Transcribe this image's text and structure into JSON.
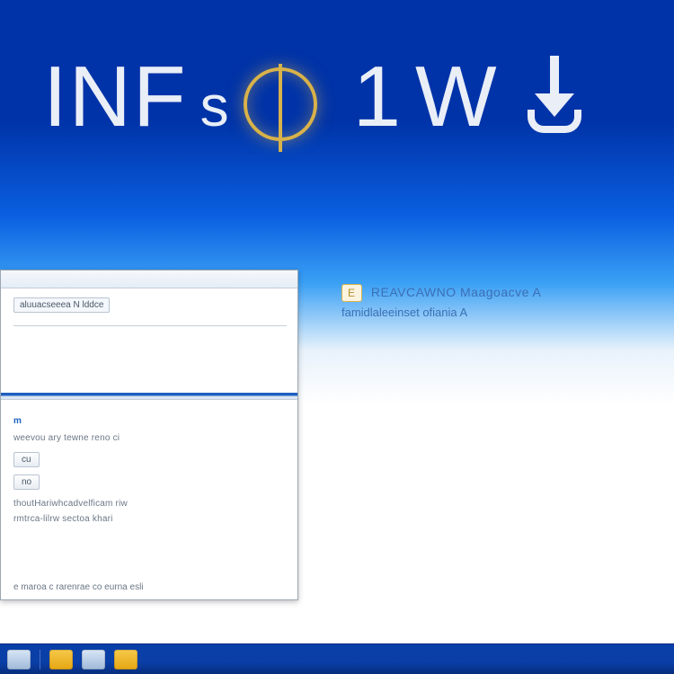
{
  "brand": {
    "segment_a": "INF",
    "segment_b": "s",
    "segment_c": "1",
    "segment_d": "W"
  },
  "info": {
    "badge": "E",
    "line1": "REAVCAWNO Maagoacve A",
    "line2": "famidlaleeinset ofiania A"
  },
  "dialog": {
    "header_chip": "aluuacseeea N lddce",
    "section_label": "m",
    "rows": [
      "weevou ary tewne reno ci",
      "eu",
      "no",
      "thoutHariwhcadvelficam riw",
      "rmtrca-lilrw sectoa khari"
    ],
    "buttons": {
      "a": "cu",
      "b": "no"
    },
    "footer": "e maroa c rarenrae co eurna esli"
  },
  "taskbar": {
    "items": [
      "start",
      "files",
      "app-1",
      "app-2"
    ]
  }
}
